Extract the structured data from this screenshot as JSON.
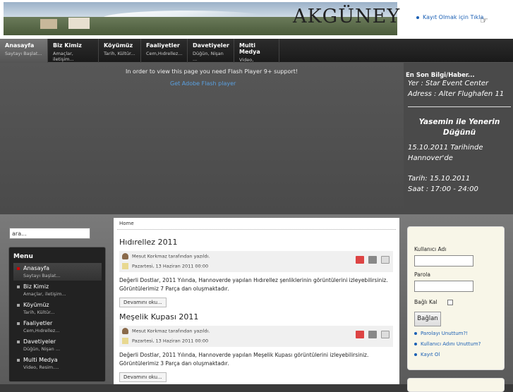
{
  "header": {
    "logo": "AKGÜNEY",
    "register_link": "Kayıt Olmak için Tıkla"
  },
  "nav": [
    {
      "title": "Anasayfa",
      "sub": "Saytayı Başlat..."
    },
    {
      "title": "Biz Kimiz",
      "sub": "Amaçlar, iletişim..."
    },
    {
      "title": "Köyümüz",
      "sub": "Tarih, Kültür..."
    },
    {
      "title": "Faaliyetler",
      "sub": "Cem,Hıdrellez..."
    },
    {
      "title": "Davetiyeler",
      "sub": "Düğün, Nişan ..."
    },
    {
      "title": "Multi Medya",
      "sub": "Video, Resim...."
    }
  ],
  "flash": {
    "message": "In order to view this page you need Flash Player 9+ support!",
    "link": "Get Adobe Flash player"
  },
  "news": {
    "heading": "En Son Bilgi/Haber...",
    "line1": "Yer : Star Event Center",
    "line2": "Adress : Alter Flughafen 11",
    "title": "Yasemin ile Yenerin Düğünü",
    "date_line": "15.10.2011 Tarihinde Hannover'de",
    "tarih": "Tarih: 15.10.2011",
    "saat": "Saat : 17:00 - 24:00"
  },
  "search": {
    "value": "ara..."
  },
  "menu": {
    "heading": "Menu",
    "items": [
      {
        "title": "Anasayfa",
        "sub": "Saytayı Başlat..."
      },
      {
        "title": "Biz Kimiz",
        "sub": "Amaçlar, iletişim..."
      },
      {
        "title": "Köyümüz",
        "sub": "Tarih, Kültür..."
      },
      {
        "title": "Faaliyetler",
        "sub": "Cem,Hıdrellez..."
      },
      {
        "title": "Davetiyeler",
        "sub": "Düğün, Nişan ..."
      },
      {
        "title": "Multi Medya",
        "sub": "Video, Resim...."
      }
    ]
  },
  "breadcrumb": "Home",
  "articles": [
    {
      "title": "Hıdırellez 2011",
      "author": "Mesut Korkmaz tarafından yazıldı.",
      "date": "Pazartesi, 13 Haziran 2011 00:00",
      "text": "Değerli Dostlar, 2011 Yılında, Hannoverde yapılan Hıdırellez şenliklerinin görüntülerini izleyebilirsiniz. Görüntülerimiz 7 Parça dan oluşmaktadır.",
      "more": "Devamını oku..."
    },
    {
      "title": "Meşelik Kupası 2011",
      "author": "Mesut Korkmaz tarafından yazıldı.",
      "date": "Pazartesi, 13 Haziran 2011 00:00",
      "text": "Değerli Dostlar, 2011 Yılında, Hannoverde yapılan Meşelik Kupası görüntülerini izleyebilirsiniz. Görüntülerimiz 3 Parça dan oluşmaktadır.",
      "more": "Devamını oku..."
    }
  ],
  "login": {
    "username_label": "Kullanıcı Adı",
    "password_label": "Parola",
    "remember_label": "Bağlı Kal",
    "button": "Bağlan",
    "links": [
      "Parolayı Unuttum?!",
      "Kullanıcı Adını Unuttum?",
      "Kayıt Ol"
    ]
  },
  "colors": {
    "link": "#1a5fb4",
    "dark_bg": "#3a3a3a",
    "active_bullet": "#cc0000"
  }
}
